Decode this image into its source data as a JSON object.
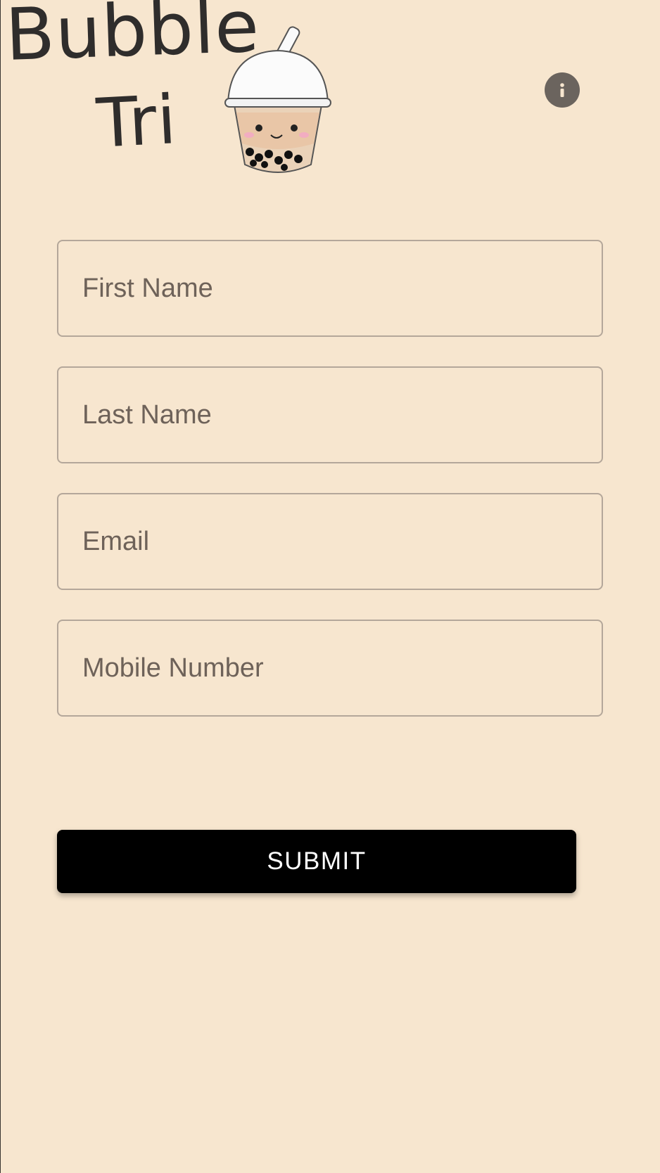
{
  "brand": {
    "line1": "Bubble",
    "line2": "Tri",
    "logo_icon": "bubble-tea-cup-icon"
  },
  "header": {
    "info_icon": "info-icon",
    "info_glyph": "i"
  },
  "form": {
    "first_name": {
      "placeholder": "First Name",
      "value": ""
    },
    "last_name": {
      "placeholder": "Last Name",
      "value": ""
    },
    "email": {
      "placeholder": "Email",
      "value": ""
    },
    "mobile": {
      "placeholder": "Mobile Number",
      "value": ""
    },
    "submit_label": "SUBMIT"
  },
  "colors": {
    "background": "#f7e6cf",
    "button": "#000000",
    "button_text": "#ffffff",
    "field_border": "#b4a79a",
    "info_icon_bg": "#6b645e"
  }
}
